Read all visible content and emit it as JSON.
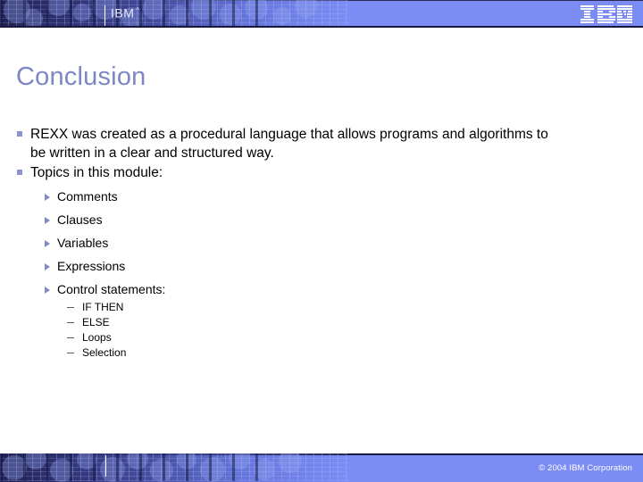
{
  "header": {
    "brand_label": "IBM",
    "trademark_mark": "^",
    "logo_name": "IBM"
  },
  "title": "Conclusion",
  "bullets": [
    {
      "text": "REXX was created as a procedural language that allows programs and algorithms to be written in a clear and structured way."
    },
    {
      "text": "Topics in this module:",
      "children": [
        {
          "text": "Comments"
        },
        {
          "text": "Clauses"
        },
        {
          "text": "Variables"
        },
        {
          "text": "Expressions"
        },
        {
          "text": "Control statements:",
          "children": [
            {
              "text": "IF THEN"
            },
            {
              "text": "ELSE"
            },
            {
              "text": "Loops"
            },
            {
              "text": "Selection"
            }
          ]
        }
      ]
    }
  ],
  "footer": {
    "copyright": "© 2004 IBM Corporation"
  },
  "colors": {
    "band": "#7b8cf5",
    "band_dark": "#181840",
    "title": "#7d86c6",
    "bullet_marker": "#8a93cf",
    "sub_marker": "#7f88c9",
    "body_text": "#000000",
    "footer_text": "#ffffff"
  }
}
